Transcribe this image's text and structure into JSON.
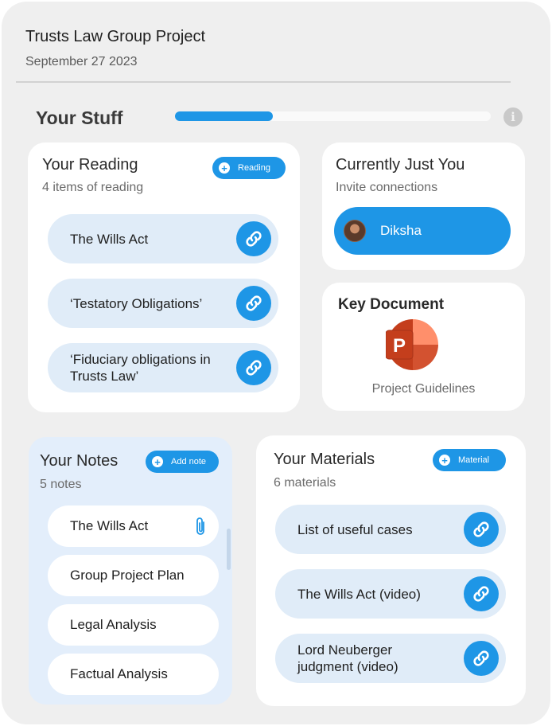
{
  "header": {
    "title": "Trusts Law Group Project",
    "date": "September 27 2023"
  },
  "stuff": {
    "title": "Your Stuff",
    "progress": 0.31,
    "info_icon": "i"
  },
  "reading": {
    "title": "Your Reading",
    "subtitle": "4 items of reading",
    "add_label": "Reading",
    "items": [
      {
        "label": "The Wills Act"
      },
      {
        "label": "‘Testatory Obligations’"
      },
      {
        "label": "‘Fiduciary obligations in Trusts Law’"
      }
    ]
  },
  "collab": {
    "title": "Currently Just You",
    "subtitle": "Invite connections",
    "person": "Diksha"
  },
  "key_document": {
    "title": "Key Document",
    "icon_letter": "P",
    "name": "Project Guidelines"
  },
  "notes": {
    "title": "Your Notes",
    "subtitle": "5 notes",
    "add_label": "Add note",
    "items": [
      {
        "label": "The Wills Act"
      },
      {
        "label": "Group Project Plan"
      },
      {
        "label": "Legal Analysis"
      },
      {
        "label": "Factual Analysis"
      }
    ]
  },
  "materials": {
    "title": "Your Materials",
    "subtitle": "6 materials",
    "add_label": "Material",
    "items": [
      {
        "label": "List of useful cases"
      },
      {
        "label": "The Wills Act (video)"
      },
      {
        "label": "Lord Neuberger judgment (video)"
      }
    ]
  },
  "colors": {
    "accent": "#1e96e6",
    "pill_bg": "#e0ecf8",
    "notes_bg": "#e3eefb",
    "powerpoint": "#d24726"
  },
  "icons": [
    "link-icon",
    "paperclip-icon",
    "plus-icon",
    "info-icon",
    "powerpoint-icon",
    "avatar"
  ]
}
